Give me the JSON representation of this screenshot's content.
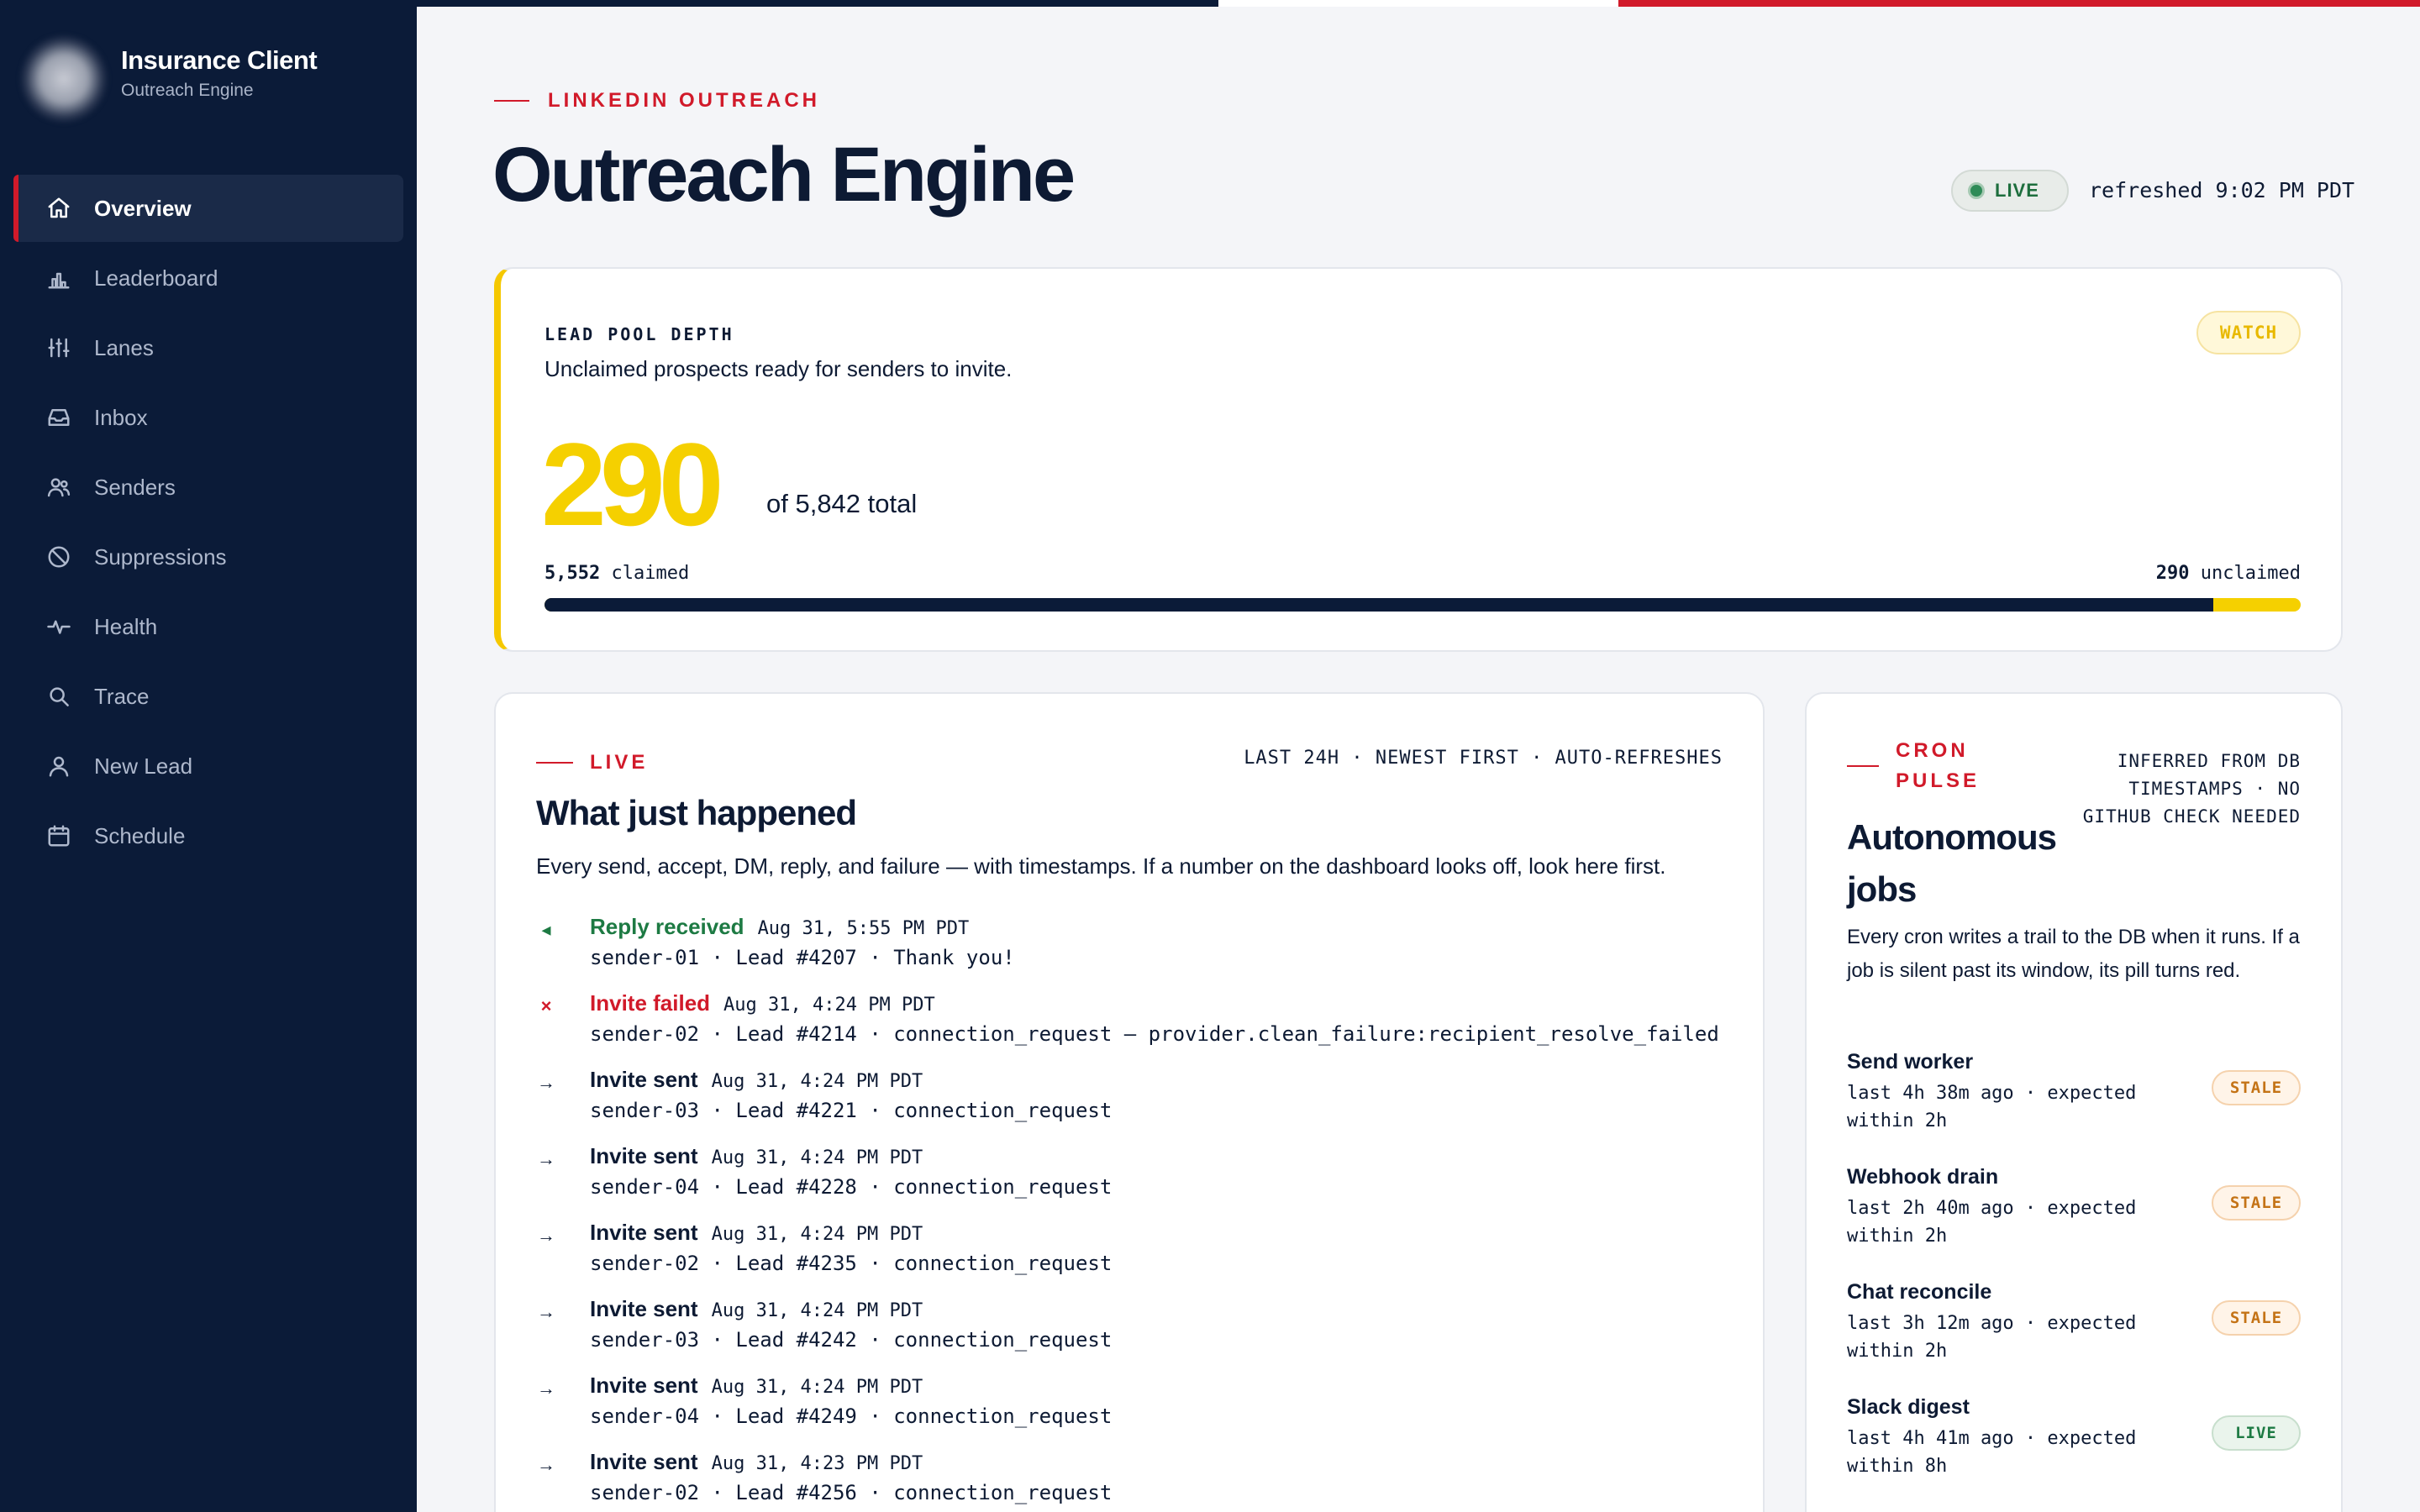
{
  "brand": {
    "title": "Insurance Client",
    "subtitle": "Outreach Engine"
  },
  "nav": [
    {
      "label": "Overview",
      "icon": "home-icon",
      "active": true
    },
    {
      "label": "Leaderboard",
      "icon": "bar-chart-icon"
    },
    {
      "label": "Lanes",
      "icon": "lanes-icon"
    },
    {
      "label": "Inbox",
      "icon": "inbox-icon"
    },
    {
      "label": "Senders",
      "icon": "users-icon"
    },
    {
      "label": "Suppressions",
      "icon": "ban-icon"
    },
    {
      "label": "Health",
      "icon": "pulse-icon"
    },
    {
      "label": "Trace",
      "icon": "search-icon"
    },
    {
      "label": "New Lead",
      "icon": "user-icon"
    },
    {
      "label": "Schedule",
      "icon": "calendar-icon"
    }
  ],
  "header": {
    "eyebrow": "LINKEDIN OUTREACH",
    "title": "Outreach Engine",
    "live_label": "LIVE",
    "refreshed": "refreshed 9:02 PM PDT"
  },
  "pool": {
    "caption": "LEAD POOL DEPTH",
    "description": "Unclaimed prospects ready for senders to invite.",
    "status": "WATCH",
    "unclaimed": "290",
    "total_text": "of 5,842 total",
    "claimed_count": "5,552",
    "claimed_word": "claimed",
    "unclaimed_count": "290",
    "unclaimed_word": "unclaimed",
    "claimed_fraction": 0.9504
  },
  "feed": {
    "eyebrow": "LIVE",
    "meta": "LAST 24H · NEWEST FIRST · AUTO-REFRESHES",
    "title": "What just happened",
    "description": "Every send, accept, DM, reply, and failure — with timestamps. If a number on the dashboard looks off, look here first.",
    "events": [
      {
        "type": "reply",
        "icon": "◂",
        "title": "Reply received",
        "time": "Aug 31, 5:55 PM PDT",
        "detail": "sender-01 · Lead #4207 · Thank you!"
      },
      {
        "type": "fail",
        "icon": "×",
        "title": "Invite failed",
        "time": "Aug 31, 4:24 PM PDT",
        "detail": "sender-02 · Lead #4214 · connection_request — provider.clean_failure:recipient_resolve_failed"
      },
      {
        "type": "sent",
        "icon": "→",
        "title": "Invite sent",
        "time": "Aug 31, 4:24 PM PDT",
        "detail": "sender-03 · Lead #4221 · connection_request"
      },
      {
        "type": "sent",
        "icon": "→",
        "title": "Invite sent",
        "time": "Aug 31, 4:24 PM PDT",
        "detail": "sender-04 · Lead #4228 · connection_request"
      },
      {
        "type": "sent",
        "icon": "→",
        "title": "Invite sent",
        "time": "Aug 31, 4:24 PM PDT",
        "detail": "sender-02 · Lead #4235 · connection_request"
      },
      {
        "type": "sent",
        "icon": "→",
        "title": "Invite sent",
        "time": "Aug 31, 4:24 PM PDT",
        "detail": "sender-03 · Lead #4242 · connection_request"
      },
      {
        "type": "sent",
        "icon": "→",
        "title": "Invite sent",
        "time": "Aug 31, 4:24 PM PDT",
        "detail": "sender-04 · Lead #4249 · connection_request"
      },
      {
        "type": "sent",
        "icon": "→",
        "title": "Invite sent",
        "time": "Aug 31, 4:23 PM PDT",
        "detail": "sender-02 · Lead #4256 · connection_request"
      }
    ]
  },
  "cron": {
    "eyebrow": "CRON PULSE",
    "meta": "INFERRED FROM DB TIMESTAMPS · NO GITHUB CHECK NEEDED",
    "title": "Autonomous jobs",
    "description": "Every cron writes a trail to the DB when it runs. If a job is silent past its window, its pill turns red.",
    "jobs": [
      {
        "name": "Send worker",
        "detail": "last 4h 38m ago · expected within 2h",
        "status": "STALE"
      },
      {
        "name": "Webhook drain",
        "detail": "last 2h 40m ago · expected within 2h",
        "status": "STALE"
      },
      {
        "name": "Chat reconcile",
        "detail": "last 3h 12m ago · expected within 2h",
        "status": "STALE"
      },
      {
        "name": "Slack digest",
        "detail": "last 4h 41m ago · expected within 8h",
        "status": "LIVE"
      }
    ]
  },
  "colors": {
    "navy": "#0b1b38",
    "red": "#d11a2a",
    "yellow": "#f5d000",
    "green": "#1d7a43"
  }
}
